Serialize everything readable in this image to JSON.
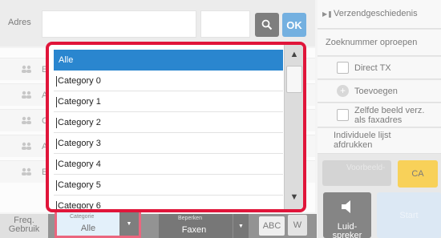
{
  "address_bar": {
    "label": "Adres",
    "search_icon": "magnifier-icon",
    "ok_label": "OK"
  },
  "address_list": {
    "rows": [
      {
        "initial": "E"
      },
      {
        "initial": "A"
      },
      {
        "initial": "C"
      },
      {
        "initial": "A"
      },
      {
        "initial": "E"
      }
    ]
  },
  "right_panel": {
    "send_history": "Verzendgeschiedenis",
    "recall_search_number": "Zoeknummer oproepen",
    "direct_tx": "Direct TX",
    "add": "Toevoegen",
    "same_image_as_fax_1": "Zelfde beeld verz.",
    "same_image_as_fax_2": "als faxadres",
    "print_individual_1": "Individuele lijst",
    "print_individual_2": "afdrukken",
    "preview": "Voorbeeld-",
    "ca": "CA",
    "speaker_1": "Luid-",
    "speaker_2": "spreker",
    "start": "Start"
  },
  "bottom_bar": {
    "freq_1": "Freq.",
    "freq_2": "Gebruik",
    "category_label": "Categorie",
    "category_value": "Alle",
    "limit_label": "Beperken",
    "limit_value": "Faxen",
    "abc": "ABC",
    "w": "W"
  },
  "dropdown": {
    "items": [
      "Alle",
      "Category 0",
      "Category 1",
      "Category 2",
      "Category 3",
      "Category 4",
      "Category 5",
      "Category 6"
    ],
    "selected_index": 0
  },
  "colors": {
    "accent_blue": "#2a86cf",
    "highlight_red": "#e0153a",
    "ca_yellow": "#f5b800"
  }
}
